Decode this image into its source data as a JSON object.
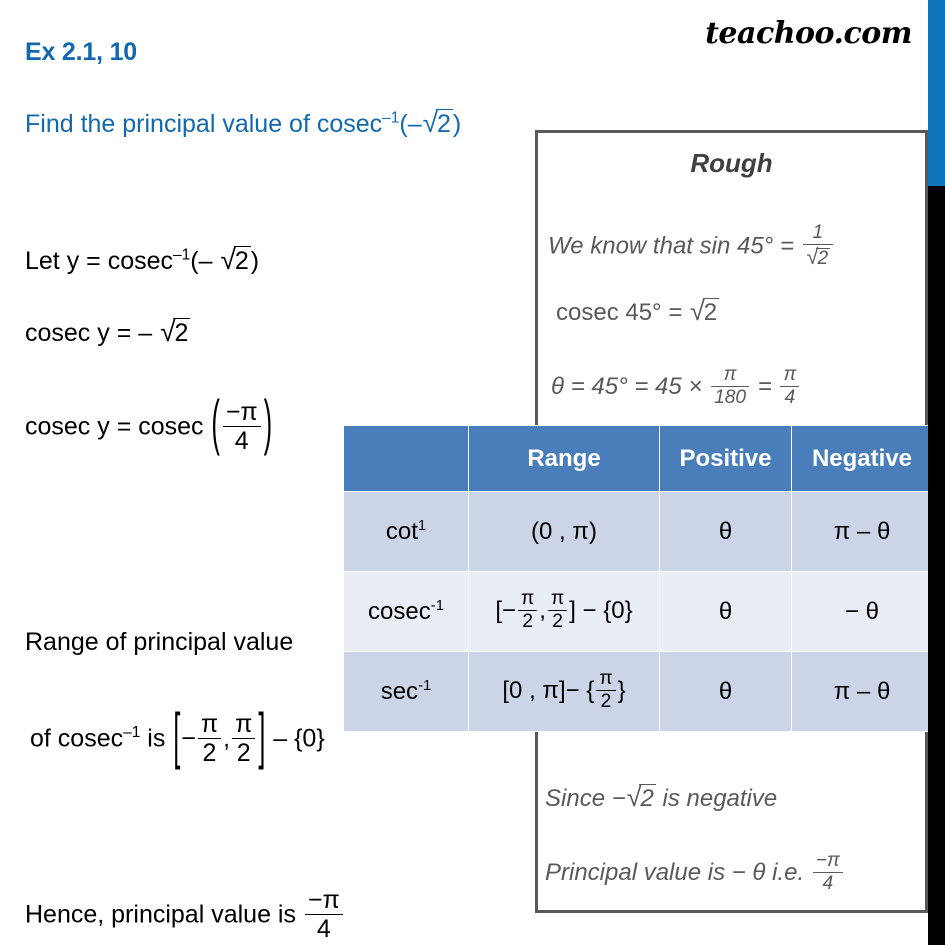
{
  "page": {
    "background_color": "#ffffff",
    "heading_color": "#1269b0",
    "table_header_color": "#4a7ebb",
    "rough_box_border_color": "#595959",
    "scrollbar_thumb_color": "#0f75bc",
    "scrollbar_track_color": "#000000"
  },
  "logo": {
    "text": "teachoo.com"
  },
  "header": {
    "exercise_label": "Ex 2.1, 10",
    "question_prefix": "Find the principal value of  cosec",
    "question_exponent": "–1",
    "question_argument_open": "(–",
    "question_sqrt_radical": "√",
    "question_sqrt_body": "2",
    "question_argument_close": ")"
  },
  "steps": {
    "let_prefix": "Let y = cosec",
    "let_exponent": "–1",
    "let_open": "(– ",
    "let_sqrt_radical": "√",
    "let_sqrt_body": "2",
    "let_close": ")",
    "cosec_y_prefix": "cosec y = – ",
    "cosec_y_sqrt_radical": "√",
    "cosec_y_sqrt_body": "2",
    "cosec_cosec_prefix": "cosec y = cosec ",
    "cosec_cosec_paren_open": "(",
    "cosec_cosec_num": "−π",
    "cosec_cosec_den": "4",
    "cosec_cosec_paren_close": ")",
    "range_line1": "Range of principal value",
    "range_line2_prefix": " of cosec",
    "range_line2_exponent": "–1",
    "range_line2_is": " is ",
    "range_bracket_open": "[",
    "range_minus": "−",
    "range_frac1_num": "π",
    "range_frac1_den": "2",
    "range_comma": ",",
    "range_frac2_num": "π",
    "range_frac2_den": "2",
    "range_bracket_close": "]",
    "range_minus_set": " – {0}",
    "hence_prefix": "Hence, principal value is ",
    "hence_num": "−π",
    "hence_den": "4"
  },
  "rough": {
    "title": "Rough",
    "line1_prefix": "We know that sin 45° = ",
    "line1_num": "1",
    "line1_den_radical": "√",
    "line1_den_body": "2",
    "line2_prefix": "cosec 45° = ",
    "line2_sqrt_radical": "√",
    "line2_sqrt_body": "2",
    "line3_prefix": "θ = 45° = 45 × ",
    "line3_frac1_num": "π",
    "line3_frac1_den": "180",
    "line3_equals": " = ",
    "line3_frac2_num": "π",
    "line3_frac2_den": "4",
    "line4_prefix": "Since −",
    "line4_sqrt_radical": "√",
    "line4_sqrt_body": "2",
    "line4_suffix": " is negative",
    "line5_prefix": "Principal value is − θ i.e. ",
    "line5_num": "−π",
    "line5_den": "4"
  },
  "table": {
    "headers": [
      "",
      "Range",
      "Positive",
      "Negative"
    ],
    "rows": [
      {
        "function_base": "cot",
        "function_exponent": "1",
        "range_text": "(0 , π)",
        "positive": "θ",
        "negative": "π – θ"
      },
      {
        "function_base": "cosec",
        "function_exponent": "-1",
        "range_open": "[−",
        "range_frac1_num": "π",
        "range_frac1_den": "2",
        "range_comma": ",",
        "range_frac2_num": "π",
        "range_frac2_den": "2",
        "range_close": "] − {0}",
        "positive": "θ",
        "negative": "− θ"
      },
      {
        "function_base": "sec",
        "function_exponent": "-1",
        "range_open": "[0 , π]− {",
        "range_frac1_num": "π",
        "range_frac1_den": "2",
        "range_close": "}",
        "positive": "θ",
        "negative": "π – θ"
      }
    ]
  }
}
